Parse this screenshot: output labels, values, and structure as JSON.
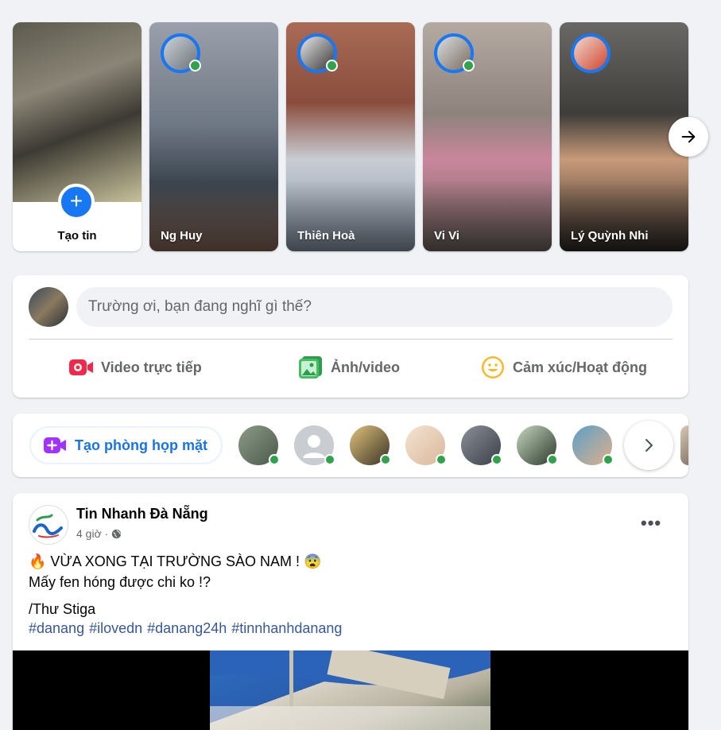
{
  "stories": {
    "create_label": "Tạo tin",
    "items": [
      {
        "name": "Ng Huy",
        "bg": "#6f7680",
        "bg2": "#3f4a52"
      },
      {
        "name": "Thiên Hoà",
        "bg": "#8b5a4a",
        "bg2": "#b8c2cc"
      },
      {
        "name": "Vi Vi",
        "bg": "#9a8f88",
        "bg2": "#c98ea2"
      },
      {
        "name": "Lý Quỳnh Nhi",
        "bg": "#55534f",
        "bg2": "#2d2b29"
      }
    ]
  },
  "composer": {
    "placeholder": "Trường ơi, bạn đang nghĩ gì thế?",
    "actions": [
      {
        "label": "Video trực tiếp",
        "icon": "live-video-icon",
        "color": "#f02849"
      },
      {
        "label": "Ảnh/video",
        "icon": "photo-video-icon",
        "color": "#45bd62"
      },
      {
        "label": "Cảm xúc/Hoạt động",
        "icon": "feeling-activity-icon",
        "color": "#f7b928"
      }
    ]
  },
  "rooms": {
    "create_label": "Tạo phòng họp mặt"
  },
  "post": {
    "page_name": "Tin Nhanh Đà Nẵng",
    "time": "4 giờ",
    "line1": "🔥 VỪA XONG TẠI TRƯỜNG SÀO NAM ! 😨",
    "line2": "Mấy fen hóng được chi ko !?",
    "line3": "/Thư Stiga",
    "hashtags": [
      "#danang",
      "#ilovedn",
      "#danang24h",
      "#tinnhanhdanang"
    ]
  },
  "colors": {
    "accent": "#1877f2",
    "online": "#31a24c",
    "link": "#385898"
  }
}
